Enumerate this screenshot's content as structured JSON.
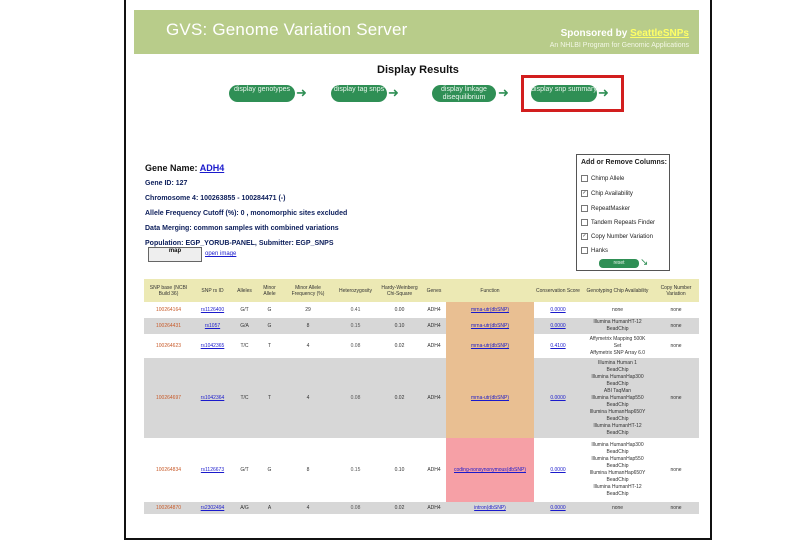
{
  "banner": {
    "title": "GVS: Genome Variation Server",
    "sponsor_prefix": "Sponsored by",
    "sponsor_link": "SeattleSNPs",
    "sub": "An NHLBI Program for Genomic Applications"
  },
  "page_heading": "Display Results",
  "nav": [
    {
      "label": "display genotypes"
    },
    {
      "label": "display tag snps"
    },
    {
      "label": "display linkage disequilibrium"
    },
    {
      "label": "display snp summary"
    }
  ],
  "info": {
    "gene_name_label": "Gene Name:",
    "gene_name": "ADH4",
    "gene_id": "Gene ID: 127",
    "chromosome": "Chromosome 4: 100263855 - 100284471 (-)",
    "allele_cutoff": "Allele Frequency Cutoff (%): 0 , monomorphic sites excluded",
    "data_merging": "Data Merging: common samples with combined variations",
    "population": "Population: EGP_YORUB-PANEL, Submitter: EGP_SNPS"
  },
  "map": {
    "thumb_label": "map",
    "open_label": "open image"
  },
  "columns_panel": {
    "title": "Add or Remove Columns:",
    "options": [
      {
        "label": "Chimp Allele",
        "checked": false
      },
      {
        "label": "Chip Availability",
        "checked": true
      },
      {
        "label": "RepeatMasker",
        "checked": false
      },
      {
        "label": "Tandem Repeats Finder",
        "checked": false
      },
      {
        "label": "Copy Number Variation",
        "checked": true
      },
      {
        "label": "Hanks",
        "checked": false
      }
    ],
    "reset_label": "reset"
  },
  "table": {
    "headers": [
      "SNP base (NCBI Build 36)",
      "SNP rs ID",
      "Alleles",
      "Minor Allele",
      "Minor Allele Frequency (%)",
      "Heterozygosity",
      "Hardy-Weinberg Chi-Square",
      "Genes",
      "Function",
      "Conservation Score",
      "Genotyping Chip Availability",
      "Copy Number Variation"
    ],
    "rows": [
      {
        "snp": "100264164",
        "rs": "rs1126400",
        "alleles": "G/T",
        "minor": "G",
        "maf": "29",
        "het": "0.41",
        "hw": "0.00",
        "gene": "ADH4",
        "fn": "mrna-utr(dbSNP)",
        "cons": "0.0000",
        "chip": [
          "none"
        ],
        "cnv": "none",
        "style": "white",
        "fn_style": "tan"
      },
      {
        "snp": "100264431",
        "rs": "rs1057",
        "alleles": "G/A",
        "minor": "G",
        "maf": "8",
        "het": "0.15",
        "hw": "0.10",
        "gene": "ADH4",
        "fn": "mrna-utr(dbSNP)",
        "cons": "0.0000",
        "chip": [
          "Illumina HumanHT-12",
          "BeadChip"
        ],
        "cnv": "none",
        "style": "gray",
        "fn_style": "tan"
      },
      {
        "snp": "100264623",
        "rs": "rs1042365",
        "alleles": "T/C",
        "minor": "T",
        "maf": "4",
        "het": "0.08",
        "hw": "0.02",
        "gene": "ADH4",
        "fn": "mrna-utr(dbSNP)",
        "cons": "0.4100",
        "chip": [
          "Affymetrix Mapping 500K",
          "Set",
          "Affymetrix SNP Array 6.0"
        ],
        "cnv": "none",
        "style": "white",
        "fn_style": "tan"
      },
      {
        "snp": "100264697",
        "rs": "rs1042364",
        "alleles": "T/C",
        "minor": "T",
        "maf": "4",
        "het": "0.08",
        "hw": "0.02",
        "gene": "ADH4",
        "fn": "mrna-utr(dbSNP)",
        "cons": "0.0000",
        "chip": [
          "Illumina Human 1",
          "BeadChip",
          "Illumina HumanHap300",
          "BeadChip",
          "ABI TaqMan",
          "Illumina HumanHap550",
          "BeadChip",
          "Illumina HumanHap650Y",
          "BeadChip",
          "Illumina HumanHT-12",
          "BeadChip"
        ],
        "cnv": "none",
        "style": "gray",
        "fn_style": "tan"
      },
      {
        "snp": "100264834",
        "rs": "rs1126673",
        "alleles": "G/T",
        "minor": "G",
        "maf": "8",
        "het": "0.15",
        "hw": "0.10",
        "gene": "ADH4",
        "fn": "coding-nonsynonymous(dbSNP)",
        "cons": "0.0000",
        "chip": [
          "Illumina HumanHap300",
          "BeadChip",
          "Illumina HumanHap550",
          "BeadChip",
          "Illumina HumanHap650Y",
          "BeadChip",
          "Illumina HumanHT-12",
          "BeadChip"
        ],
        "cnv": "none",
        "style": "white",
        "fn_style": "pink"
      },
      {
        "snp": "100264870",
        "rs": "rs2302494",
        "alleles": "A/G",
        "minor": "A",
        "maf": "4",
        "het": "0.08",
        "hw": "0.02",
        "gene": "ADH4",
        "fn": "intron(dbSNP)",
        "cons": "0.0000",
        "chip": [
          "none"
        ],
        "cnv": "none",
        "style": "gray",
        "fn_style": ""
      }
    ]
  }
}
